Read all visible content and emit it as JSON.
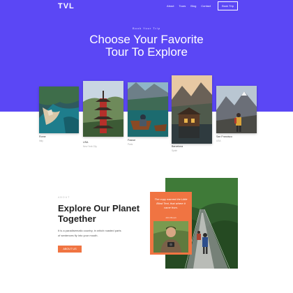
{
  "header": {
    "logo": "TVL",
    "nav": [
      "About",
      "Tours",
      "Blog",
      "Contact"
    ],
    "cta": "Book Trip"
  },
  "hero": {
    "eyebrow": "Book Your Trip",
    "title_line1": "Choose Your Favorite",
    "title_line2": "Tour To Explore"
  },
  "destinations": [
    {
      "city": "Rome",
      "country": "Italy"
    },
    {
      "city": "USA",
      "country": "New York City"
    },
    {
      "city": "France",
      "country": "Paris"
    },
    {
      "city": "Barcelona",
      "country": "Spain"
    },
    {
      "city": "San Francisco",
      "country": "USA"
    }
  ],
  "about": {
    "eyebrow": "ABOUT",
    "title": "Explore Our Planet Together",
    "description": "It is a paradisematic country, in which roasted parts of sentences fly into your mouth.",
    "button": "ABOUT US"
  },
  "testimonial": {
    "quote": "The copy warned the Little Blind Text, that where it came from.",
    "author": "John Brown"
  },
  "colors": {
    "hero_bg": "#5b47f5",
    "accent": "#f07442",
    "white": "#ffffff"
  }
}
